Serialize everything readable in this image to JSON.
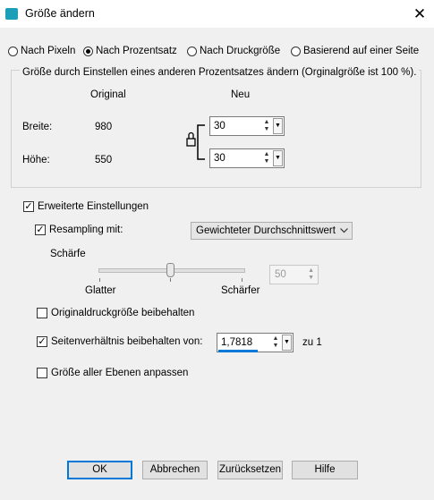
{
  "window": {
    "title": "Größe ändern",
    "close_symbol": "✕"
  },
  "mode": {
    "options": [
      "Nach Pixeln",
      "Nach Prozentsatz",
      "Nach Druckgröße",
      "Basierend auf einer Seite"
    ],
    "selected": "Nach Prozentsatz"
  },
  "group": {
    "title": "Größe durch Einstellen eines anderen Prozentsatzes ändern (Orginalgröße ist 100 %).",
    "col_original": "Original",
    "col_new": "Neu",
    "width_label": "Breite:",
    "width_original": "980",
    "width_new": "30",
    "height_label": "Höhe:",
    "height_original": "550",
    "height_new": "30"
  },
  "advanced": {
    "label": "Erweiterte Einstellungen",
    "checked": true,
    "resampling_label": "Resampling mit:",
    "resampling_checked": true,
    "resampling_value": "Gewichteter Durchschnittswert",
    "sharpness_label": "Schärfe",
    "slider_min_label": "Glatter",
    "slider_max_label": "Schärfer",
    "sharpness_value": "50",
    "keep_print_size_label": "Originaldruckgröße beibehalten",
    "keep_print_size_checked": false,
    "aspect_label": "Seitenverhältnis beibehalten von:",
    "aspect_checked": true,
    "aspect_value": "1,7818",
    "aspect_suffix": "zu 1",
    "resize_layers_label": "Größe aller Ebenen anpassen",
    "resize_layers_checked": false
  },
  "buttons": {
    "ok": "OK",
    "cancel": "Abbrechen",
    "reset": "Zurücksetzen",
    "help": "Hilfe"
  },
  "colors": {
    "accent": "#0078d7",
    "app_icon": "#1b9fb8"
  }
}
